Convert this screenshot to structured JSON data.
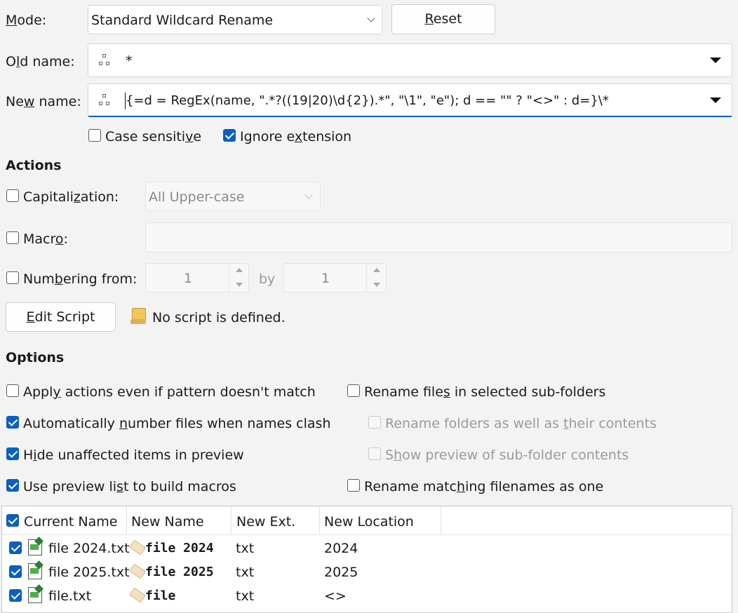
{
  "mode": {
    "label": "Mode:",
    "value": "Standard Wildcard Rename",
    "reset": "Reset"
  },
  "old_name": {
    "label": "Old name:",
    "value": "*"
  },
  "new_name": {
    "label": "New name:",
    "value": "{=d = RegEx(name, \".*?((19|20)\\d{2}).*\", \"\\1\", \"e\"); d == \"\" ? \"<>\" : d=}\\*"
  },
  "case_sensitive": {
    "label": "Case sensitive",
    "checked": false
  },
  "ignore_extension": {
    "label": "Ignore extension",
    "checked": true
  },
  "actions": {
    "heading": "Actions",
    "capitalization": {
      "label": "Capitalization:",
      "value": "All Upper-case",
      "checked": false
    },
    "macro": {
      "label": "Macro:",
      "value": "",
      "checked": false
    },
    "numbering": {
      "label": "Numbering from:",
      "from": "1",
      "by_label": "by",
      "by": "1",
      "checked": false
    },
    "edit_script": "Edit Script",
    "script_status": "No script is defined."
  },
  "options": {
    "heading": "Options",
    "apply_actions": {
      "label": "Apply actions even if pattern doesn't match",
      "checked": false
    },
    "auto_number": {
      "label": "Automatically number files when names clash",
      "checked": true
    },
    "hide_unaffected": {
      "label": "Hide unaffected items in preview",
      "checked": true
    },
    "preview_macros": {
      "label": "Use preview list to build macros",
      "checked": true
    },
    "rename_subfolders": {
      "label": "Rename files in selected sub-folders",
      "checked": false
    },
    "rename_folders": {
      "label": "Rename folders as well as their contents",
      "checked": false,
      "enabled": false
    },
    "show_preview": {
      "label": "Show preview of sub-folder contents",
      "checked": false,
      "enabled": false
    },
    "rename_matching": {
      "label": "Rename matching filenames as one",
      "checked": false
    }
  },
  "preview": {
    "columns": [
      "Current Name",
      "New Name",
      "New Ext.",
      "New Location"
    ],
    "rows": [
      {
        "current": "file 2024.txt",
        "new": "file 2024",
        "ext": "txt",
        "location": "2024"
      },
      {
        "current": "file 2025.txt",
        "new": "file 2025",
        "ext": "txt",
        "location": "2025"
      },
      {
        "current": "file.txt",
        "new": "file",
        "ext": "txt",
        "location": "<>"
      }
    ]
  },
  "colors": {
    "accent": "#0a5fc2",
    "background": "#f3f3f3"
  }
}
